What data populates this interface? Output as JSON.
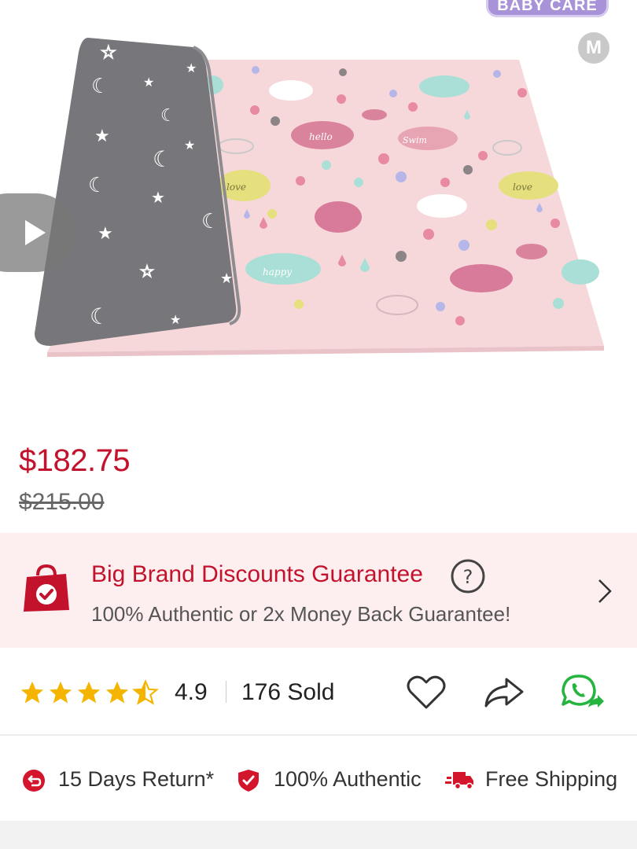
{
  "product_image": {
    "brand_badge": "BABY CARE",
    "badge_letter": "M",
    "mat_words": [
      "hello",
      "Swim",
      "love",
      "love",
      "happy"
    ]
  },
  "price": {
    "current": "$182.75",
    "original": "$215.00"
  },
  "guarantee": {
    "title": "Big Brand Discounts Guarantee",
    "subtitle": "100% Authentic or 2x Money Back Guarantee!",
    "accent": "#c3122c"
  },
  "rating": {
    "value": "4.9",
    "stars": 4.5,
    "sold": "176 Sold"
  },
  "features": [
    {
      "label": "15 Days Return*",
      "icon": "return-icon"
    },
    {
      "label": "100% Authentic",
      "icon": "shield-check-icon"
    },
    {
      "label": "Free Shipping",
      "icon": "truck-icon"
    }
  ],
  "colors": {
    "price_red": "#c3122c",
    "banner_bg": "#fdeff0",
    "star_yellow": "#f5b400",
    "whatsapp_green": "#25b43e"
  }
}
